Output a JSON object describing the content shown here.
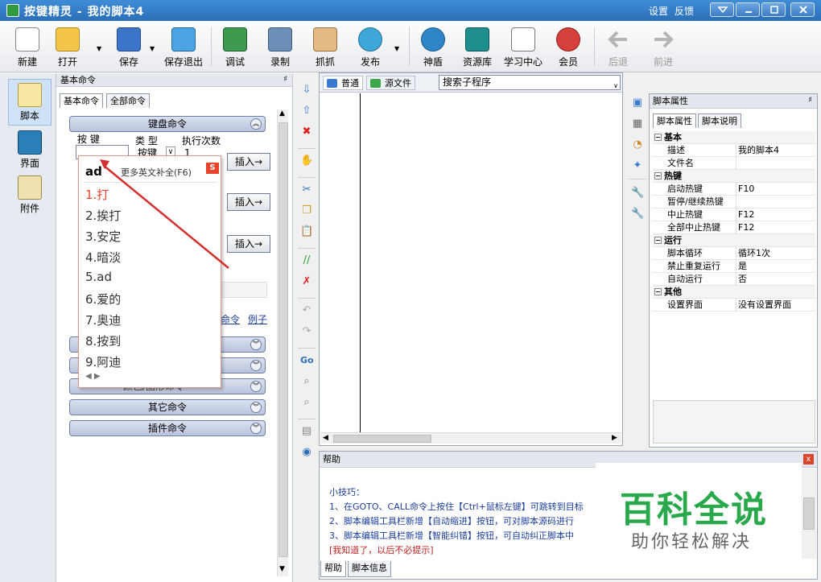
{
  "titlebar": {
    "app": "按键精灵",
    "separator": "-",
    "doc": "我的脚本4",
    "settings": "设置",
    "feedback": "反馈"
  },
  "toolbar": {
    "new": "新建",
    "open": "打开",
    "save": "保存",
    "save_exit": "保存退出",
    "debug": "调试",
    "record": "录制",
    "capture": "抓抓",
    "publish": "发布",
    "shield": "神盾",
    "resources": "资源库",
    "learn": "学习中心",
    "member": "会员",
    "back": "后退",
    "forward": "前进"
  },
  "leftbar": {
    "script": "脚本",
    "ui": "界面",
    "attach": "附件"
  },
  "panel": {
    "title": "基本命令",
    "pin": "♯",
    "tab_basic": "基本命令",
    "tab_all": "全部命令",
    "cat_keyboard": "键盘命令",
    "label_key": "按 键",
    "label_type": "类 型",
    "label_count": "执行次数",
    "type_value": "按键",
    "count_value": "1",
    "insert": "插入→",
    "link_cmd": "命令",
    "link_example": "例子",
    "cat_other": "其它命令",
    "cat_plugin": "插件命令",
    "cat_color_partial": "颜色/图形命令"
  },
  "popup": {
    "input": "ad",
    "more": "更多英文补全(F6)",
    "logo": "S",
    "candidates": [
      "1.打",
      "2.挨打",
      "3.安定",
      "4.暗淡",
      "5.ad",
      "6.爱的",
      "7.奥迪",
      "8.按到",
      "9.阿迪"
    ],
    "nav": "◀ ▶"
  },
  "editor": {
    "tab_normal": "普通",
    "tab_source": "源文件",
    "search_placeholder": "搜索子程序"
  },
  "help": {
    "title": "帮助",
    "close": "x",
    "tip_label": "小技巧：",
    "line1": "1、在GOTO、CALL命令上按住【Ctrl+鼠标左键】可跳转到目标",
    "line2": "2、脚本编辑工具栏新增【自动缩进】按钮，可对脚本源码进行",
    "line3": "3、脚本编辑工具栏新增【智能纠错】按钮，可自动纠正脚本中",
    "dismiss": "[我知道了，以后不必提示]",
    "tab_help": "帮助",
    "tab_info": "脚本信息"
  },
  "watermark": {
    "big": "百科全说",
    "small": "助你轻松解决"
  },
  "props": {
    "title": "脚本属性",
    "pin": "♯",
    "tab_props": "脚本属性",
    "tab_desc": "脚本说明",
    "rows": [
      {
        "g": "基本"
      },
      {
        "k": "描述",
        "v": "我的脚本4"
      },
      {
        "k": "文件名",
        "v": ""
      },
      {
        "g": "热键"
      },
      {
        "k": "启动热键",
        "v": "F10"
      },
      {
        "k": "暂停/继续热键",
        "v": ""
      },
      {
        "k": "中止热键",
        "v": "F12"
      },
      {
        "k": "全部中止热键",
        "v": "F12"
      },
      {
        "g": "运行"
      },
      {
        "k": "脚本循环",
        "v": "循环1次"
      },
      {
        "k": "禁止重复运行",
        "v": "是"
      },
      {
        "k": "自动运行",
        "v": "否"
      },
      {
        "g": "其他"
      },
      {
        "k": "设置界面",
        "v": "没有设置界面"
      }
    ]
  },
  "colors": {
    "accent": "#2b6fb7",
    "brand_green": "#29a94b",
    "alert_red": "#e8432b"
  }
}
